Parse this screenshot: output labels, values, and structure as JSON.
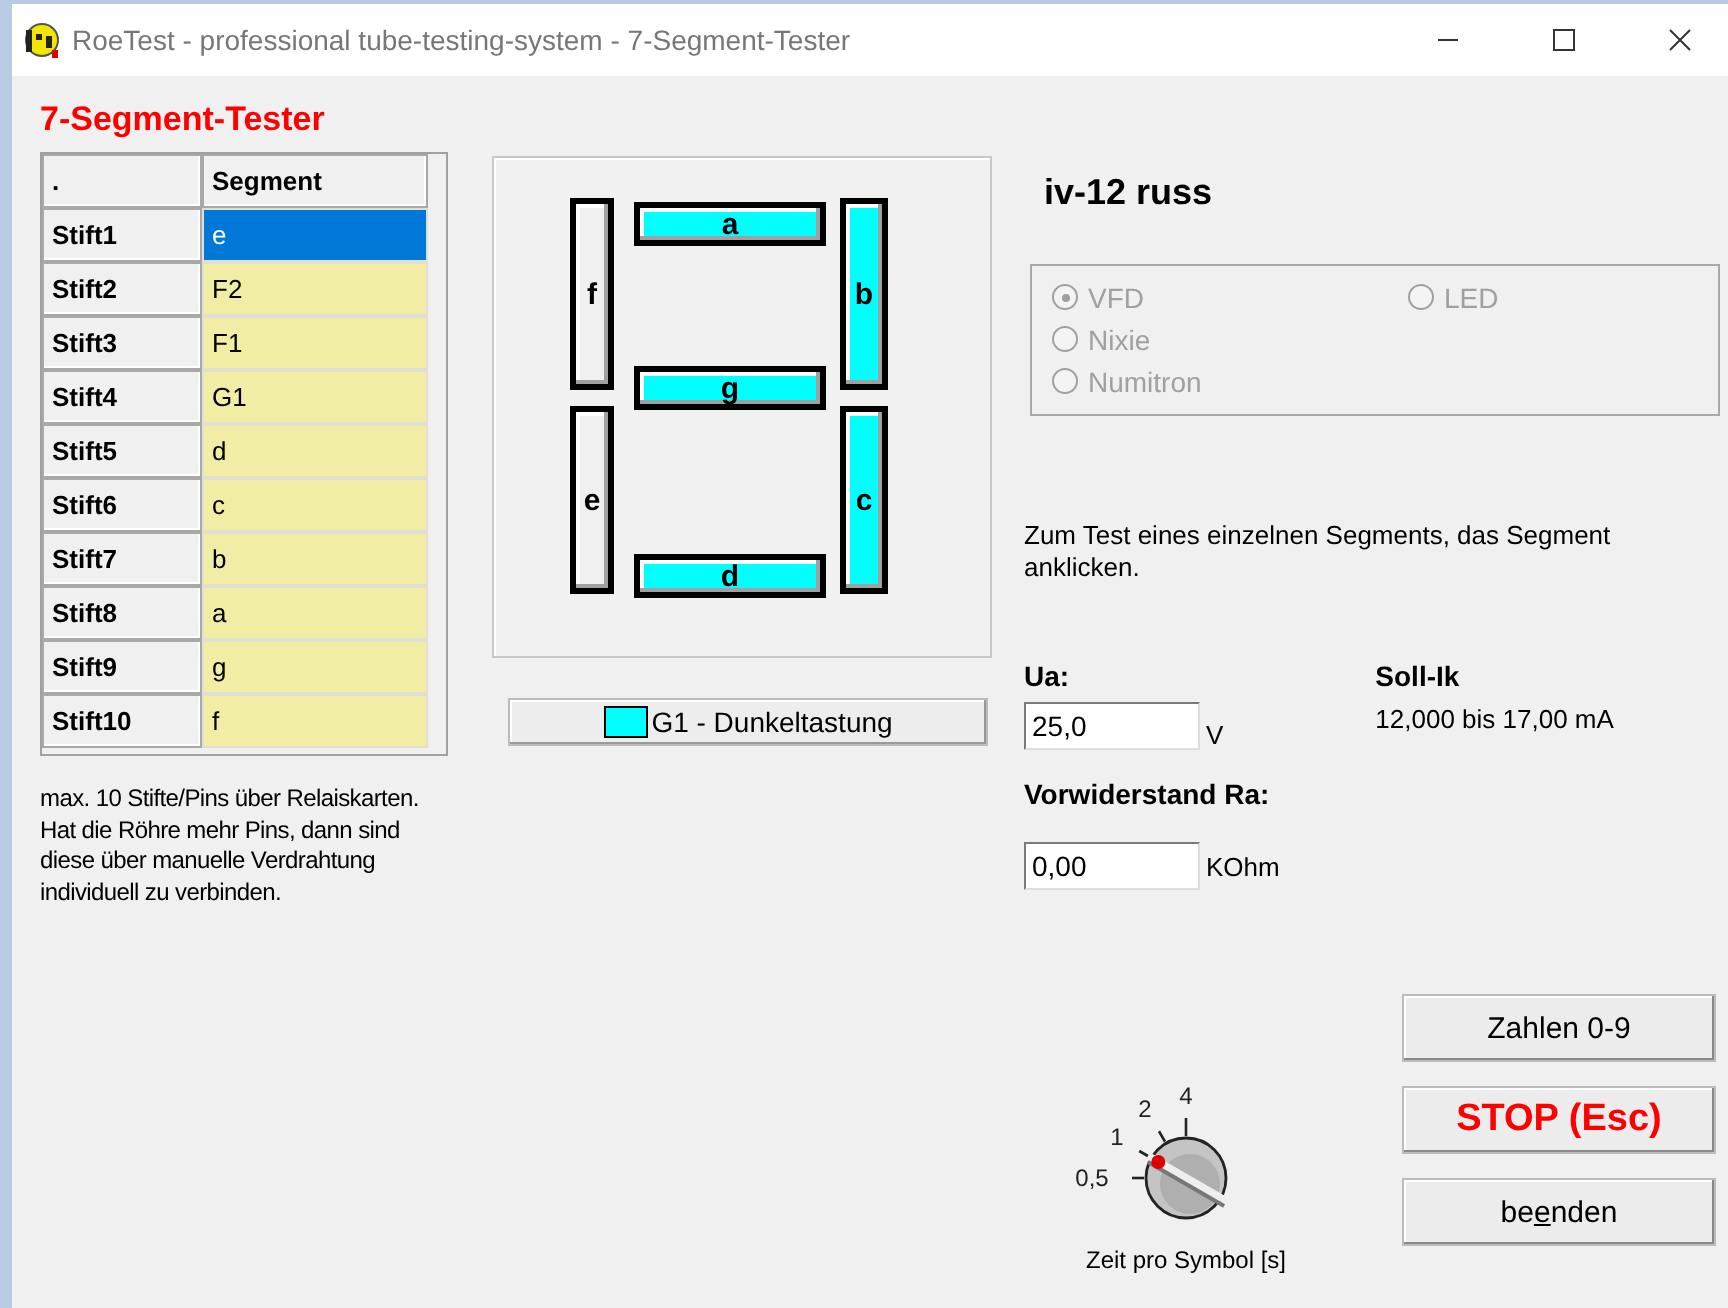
{
  "window": {
    "title": "RoeTest - professional tube-testing-system - 7-Segment-Tester"
  },
  "heading": "7-Segment-Tester",
  "table": {
    "columns": [
      ".",
      "Segment"
    ],
    "rows": [
      {
        "pin": "Stift1",
        "segment": "e",
        "selected": true
      },
      {
        "pin": "Stift2",
        "segment": "F2",
        "selected": false
      },
      {
        "pin": "Stift3",
        "segment": "F1",
        "selected": false
      },
      {
        "pin": "Stift4",
        "segment": "G1",
        "selected": false
      },
      {
        "pin": "Stift5",
        "segment": "d",
        "selected": false
      },
      {
        "pin": "Stift6",
        "segment": "c",
        "selected": false
      },
      {
        "pin": "Stift7",
        "segment": "b",
        "selected": false
      },
      {
        "pin": "Stift8",
        "segment": "a",
        "selected": false
      },
      {
        "pin": "Stift9",
        "segment": "g",
        "selected": false
      },
      {
        "pin": "Stift10",
        "segment": "f",
        "selected": false
      }
    ]
  },
  "note": "max. 10 Stifte/Pins über Relaiskarten. Hat die Röhre mehr Pins, dann sind diese über manuelle Verdrahtung individuell zu verbinden.",
  "segments": [
    {
      "label": "f",
      "lit": false
    },
    {
      "label": "a",
      "lit": true
    },
    {
      "label": "b",
      "lit": true
    },
    {
      "label": "g",
      "lit": true
    },
    {
      "label": "e",
      "lit": false
    },
    {
      "label": "c",
      "lit": true
    },
    {
      "label": "d",
      "lit": true
    }
  ],
  "grid_button": {
    "label": "G1 - Dunkeltastung",
    "lit": true
  },
  "tube_name": "iv-12 russ",
  "display_types": [
    {
      "label": "VFD",
      "checked": true,
      "disabled": true
    },
    {
      "label": "Nixie",
      "checked": false,
      "disabled": true
    },
    {
      "label": "Numitron",
      "checked": false,
      "disabled": true
    },
    {
      "label": "LED",
      "checked": false,
      "disabled": true
    }
  ],
  "hint": "Zum Test eines einzelnen Segments, das Segment anklicken.",
  "ua": {
    "label": "Ua:",
    "value": "25,0",
    "unit": "V"
  },
  "soll_ik": {
    "label": "Soll-Ik",
    "value": "12,000 bis 17,00  mA"
  },
  "ra": {
    "label": "Vorwiderstand Ra:",
    "value": "0,00",
    "unit": "KOhm"
  },
  "knob": {
    "label": "Zeit pro Symbol [s]",
    "ticks": [
      {
        "label": "0,5"
      },
      {
        "label": "1"
      },
      {
        "label": "2"
      },
      {
        "label": "4"
      }
    ]
  },
  "buttons": [
    {
      "kind": "normal",
      "before": "Zahlen 0-9"
    },
    {
      "kind": "stop",
      "before": "STOP (Esc)"
    },
    {
      "kind": "normal",
      "before": "be",
      "key": "e",
      "after": "nden"
    }
  ]
}
